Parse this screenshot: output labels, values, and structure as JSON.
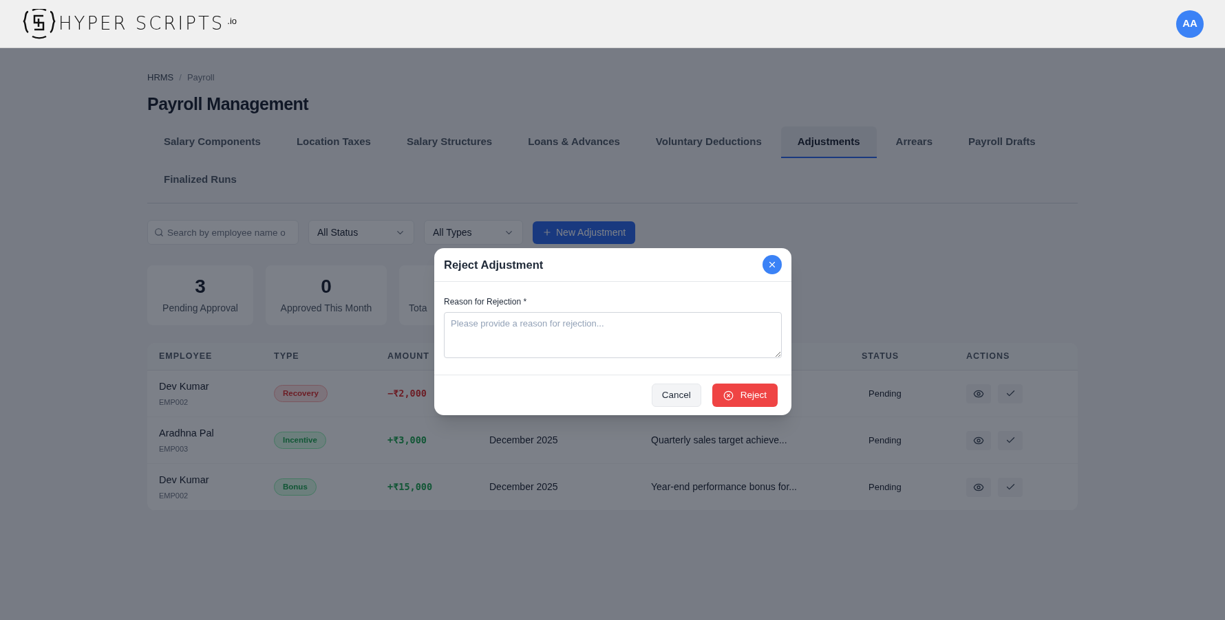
{
  "header": {
    "logo_text": "HYPER SCRIPTS",
    "logo_suffix": ".io",
    "avatar": "AA"
  },
  "breadcrumb": {
    "items": [
      "HRMS",
      "Payroll"
    ],
    "separator": "/"
  },
  "title": "Payroll Management",
  "tabs": [
    {
      "label": "Salary Components",
      "selected": false
    },
    {
      "label": "Location Taxes",
      "selected": false
    },
    {
      "label": "Salary Structures",
      "selected": false
    },
    {
      "label": "Loans & Advances",
      "selected": false
    },
    {
      "label": "Voluntary Deductions",
      "selected": false
    },
    {
      "label": "Adjustments",
      "selected": true
    },
    {
      "label": "Arrears",
      "selected": false
    },
    {
      "label": "Payroll Drafts",
      "selected": false
    },
    {
      "label": "Finalized Runs",
      "selected": false
    }
  ],
  "filters": {
    "search_placeholder": "Search by employee name o",
    "status": "All Status",
    "type": "All Types",
    "new_button": "New Adjustment"
  },
  "stats": [
    {
      "value": "3",
      "label": "Pending Approval"
    },
    {
      "value": "0",
      "label": "Approved This Month"
    },
    {
      "label": "Tota"
    }
  ],
  "table": {
    "columns": [
      "EMPLOYEE",
      "TYPE",
      "AMOUNT",
      "STATUS",
      "ACTIONS"
    ],
    "rows": [
      {
        "name": "Dev Kumar",
        "id": "EMP002",
        "type": {
          "label": "Recovery",
          "kind": "debit"
        },
        "amount": "−₹2,000",
        "status": "Pending"
      },
      {
        "name": "Aradhna Pal",
        "id": "EMP003",
        "type": {
          "label": "Incentive",
          "kind": "credit"
        },
        "amount": "+₹3,000",
        "period": "December 2025",
        "reason": "Quarterly sales target achieve...",
        "status": "Pending"
      },
      {
        "name": "Dev Kumar",
        "id": "EMP002",
        "type": {
          "label": "Bonus",
          "kind": "credit"
        },
        "amount": "+₹15,000",
        "period": "December 2025",
        "reason": "Year-end performance bonus for...",
        "status": "Pending"
      }
    ]
  },
  "modal": {
    "title": "Reject Adjustment",
    "field_label": "Reason for Rejection *",
    "placeholder": "Please provide a reason for rejection...",
    "cancel": "Cancel",
    "confirm": "Reject"
  }
}
